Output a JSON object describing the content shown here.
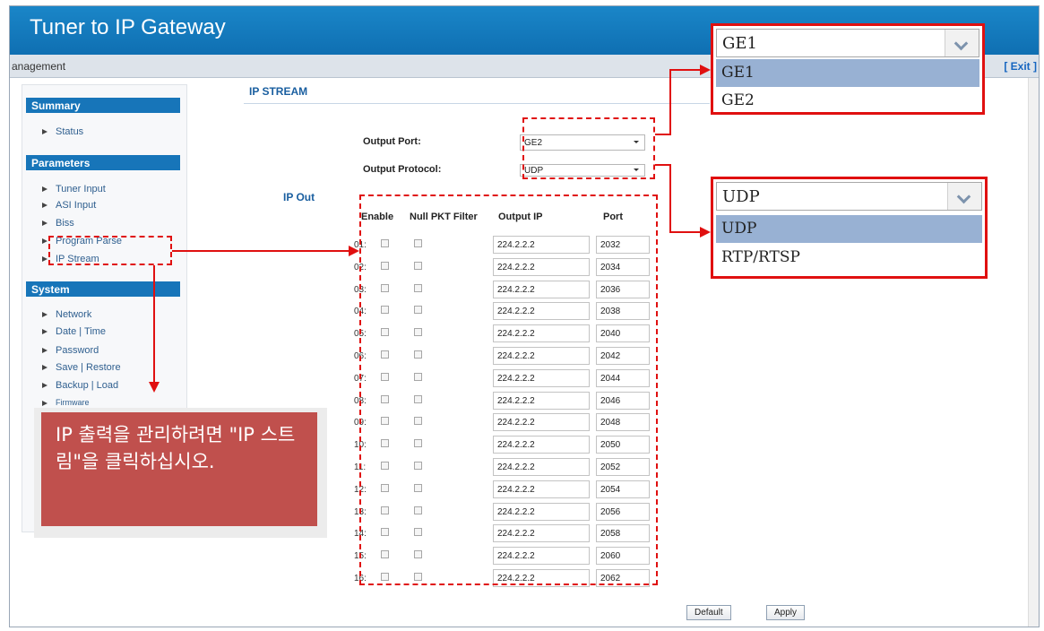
{
  "header": {
    "title": "Tuner to IP Gateway"
  },
  "subbar": {
    "text": "anagement",
    "exit": "[ Exit ]"
  },
  "sidebar": {
    "groups": [
      {
        "label": "Summary",
        "items": [
          "Status"
        ]
      },
      {
        "label": "Parameters",
        "items": [
          "Tuner Input",
          "ASI Input",
          "Biss",
          "Program Parse",
          "IP Stream"
        ]
      },
      {
        "label": "System",
        "items": [
          "Network",
          "Date | Time",
          "Password",
          "Save | Restore",
          "Backup | Load",
          "Firmware"
        ]
      }
    ]
  },
  "main": {
    "section_title": "IP STREAM",
    "output_port_label": "Output Port:",
    "output_port_value": "GE2",
    "output_protocol_label": "Output Protocol:",
    "output_protocol_value": "UDP",
    "ip_out_label": "IP Out",
    "columns": [
      "Enable",
      "Null PKT Filter",
      "Output IP",
      "Port"
    ],
    "rows": [
      {
        "num": "01:",
        "ip": "224.2.2.2",
        "port": "2032"
      },
      {
        "num": "02:",
        "ip": "224.2.2.2",
        "port": "2034"
      },
      {
        "num": "03:",
        "ip": "224.2.2.2",
        "port": "2036"
      },
      {
        "num": "04:",
        "ip": "224.2.2.2",
        "port": "2038"
      },
      {
        "num": "05:",
        "ip": "224.2.2.2",
        "port": "2040"
      },
      {
        "num": "06:",
        "ip": "224.2.2.2",
        "port": "2042"
      },
      {
        "num": "07:",
        "ip": "224.2.2.2",
        "port": "2044"
      },
      {
        "num": "08:",
        "ip": "224.2.2.2",
        "port": "2046"
      },
      {
        "num": "09:",
        "ip": "224.2.2.2",
        "port": "2048"
      },
      {
        "num": "10:",
        "ip": "224.2.2.2",
        "port": "2050"
      },
      {
        "num": "11:",
        "ip": "224.2.2.2",
        "port": "2052"
      },
      {
        "num": "12:",
        "ip": "224.2.2.2",
        "port": "2054"
      },
      {
        "num": "13:",
        "ip": "224.2.2.2",
        "port": "2056"
      },
      {
        "num": "14:",
        "ip": "224.2.2.2",
        "port": "2058"
      },
      {
        "num": "15:",
        "ip": "224.2.2.2",
        "port": "2060"
      },
      {
        "num": "16:",
        "ip": "224.2.2.2",
        "port": "2062"
      }
    ],
    "default_button": "Default",
    "apply_button": "Apply"
  },
  "port_popup": {
    "current": "GE1",
    "options": [
      "GE1",
      "GE2"
    ],
    "selected": "GE1"
  },
  "protocol_popup": {
    "current": "UDP",
    "options": [
      "UDP",
      "RTP/RTSP"
    ],
    "selected": "UDP"
  },
  "callout": {
    "text": "IP 출력을 관리하려면 \"IP 스트림\"을 클릭하십시오."
  },
  "colors": {
    "header": "#1a86c8",
    "sidebar_group": "#1775b9",
    "annotation": "#e01010",
    "callout": "#c0504d",
    "popup_selected": "#98b1d3"
  }
}
